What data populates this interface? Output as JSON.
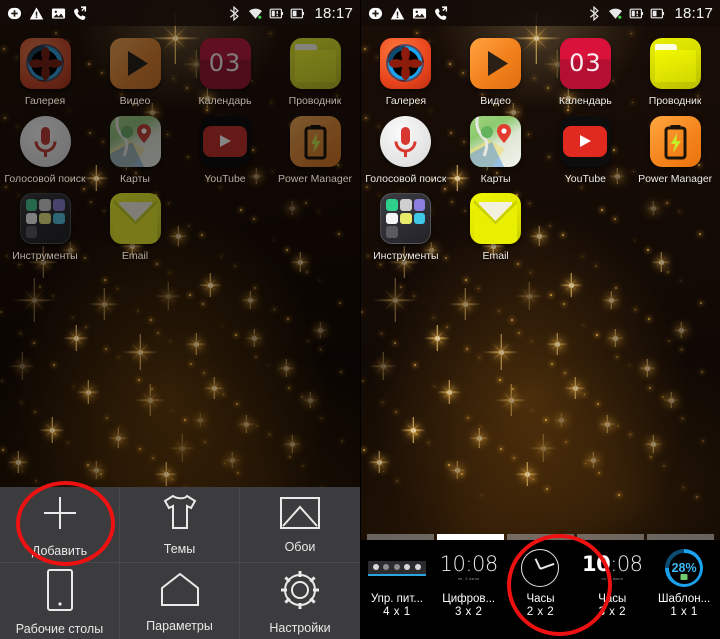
{
  "statusbar": {
    "left_icons": [
      "add-circle-icon",
      "warning-triangle-icon",
      "image-icon",
      "missed-call-icon"
    ],
    "right_icons": [
      "bluetooth-icon",
      "wifi-icon",
      "sim-alert-icon",
      "battery-icon"
    ],
    "time": "18:17"
  },
  "home": {
    "apps": [
      [
        {
          "label": "Галерея",
          "icon": "gallery-icon"
        },
        {
          "label": "Видео",
          "icon": "video-icon"
        },
        {
          "label": "Календарь",
          "icon": "calendar-icon",
          "day": "03"
        },
        {
          "label": "Проводник",
          "icon": "file-explorer-icon"
        }
      ],
      [
        {
          "label": "Голосовой поиск",
          "icon": "voice-search-icon"
        },
        {
          "label": "Карты",
          "icon": "maps-icon"
        },
        {
          "label": "YouTube",
          "icon": "youtube-icon"
        },
        {
          "label": "Power Manager",
          "icon": "power-manager-icon"
        }
      ],
      [
        {
          "label": "Инструменты",
          "icon": "tools-folder-icon"
        },
        {
          "label": "Email",
          "icon": "email-icon"
        }
      ]
    ]
  },
  "menu": {
    "items": [
      {
        "label": "Добавить",
        "icon": "plus-icon",
        "highlighted": true
      },
      {
        "label": "Темы",
        "icon": "tshirt-icon"
      },
      {
        "label": "Обои",
        "icon": "wallpaper-image-icon"
      },
      {
        "label": "Рабочие столы",
        "icon": "phone-screen-icon"
      },
      {
        "label": "Параметры",
        "icon": "home-icon"
      },
      {
        "label": "Настройки",
        "icon": "gear-icon"
      }
    ]
  },
  "widget_tray": {
    "page_count": 5,
    "active_page": 2,
    "widgets": [
      {
        "name": "Упр. пит...",
        "size": "4 x 1",
        "thumb": "power-control-bar-thumb"
      },
      {
        "name": "Цифров...",
        "size": "3 x 2",
        "thumb": "digital-clock-thin-thumb",
        "time": "10:08",
        "date": "пн, 3 июня"
      },
      {
        "name": "Часы",
        "size": "2 x 2",
        "thumb": "analog-clock-thumb",
        "highlighted": true
      },
      {
        "name": "Часы",
        "size": "3 x 2",
        "thumb": "digital-clock-bold-thumb",
        "time_bold": "10",
        "time_thin": ":08",
        "date": "пн, 3 июня"
      },
      {
        "name": "Шаблон...",
        "size": "1 x 1",
        "thumb": "battery-ring-thumb",
        "percent": "28%"
      }
    ]
  },
  "colors": {
    "annotation": "#ee1111",
    "menu_bg": "#3c3c3e",
    "ring_blue": "#1aa3ef"
  }
}
